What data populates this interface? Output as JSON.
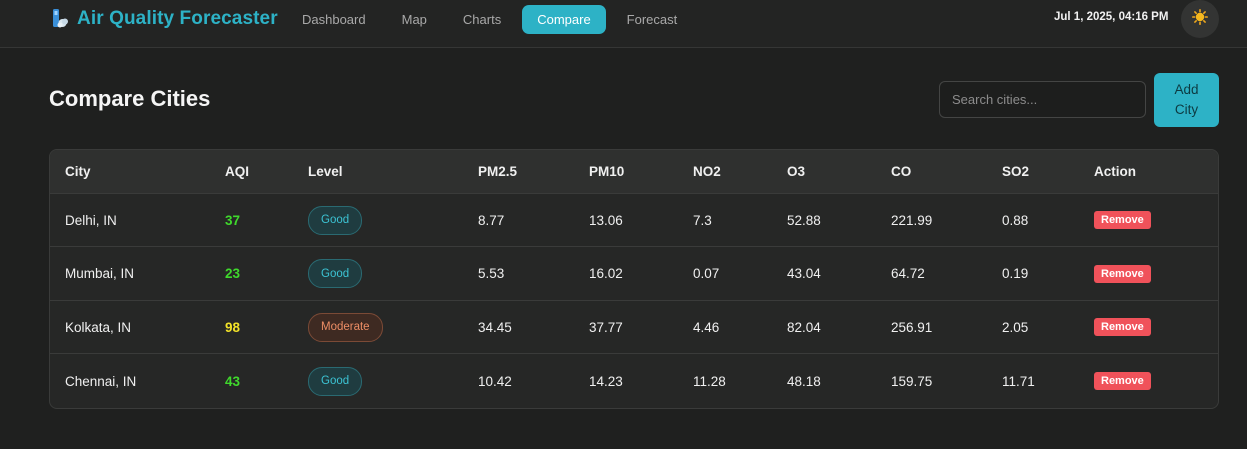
{
  "header": {
    "app_title": "Air Quality Forecaster",
    "nav": [
      {
        "label": "Dashboard",
        "active": false
      },
      {
        "label": "Map",
        "active": false
      },
      {
        "label": "Charts",
        "active": false
      },
      {
        "label": "Compare",
        "active": true
      },
      {
        "label": "Forecast",
        "active": false
      }
    ],
    "datetime": "Jul 1, 2025, 04:16 PM",
    "theme_icon": "sun-icon"
  },
  "main": {
    "title": "Compare Cities",
    "search_placeholder": "Search cities...",
    "add_button": "Add City"
  },
  "table": {
    "columns": [
      "City",
      "AQI",
      "Level",
      "PM2.5",
      "PM10",
      "NO2",
      "O3",
      "CO",
      "SO2",
      "Action"
    ],
    "rows": [
      {
        "city": "Delhi, IN",
        "aqi": "37",
        "level": "Good",
        "pm25": "8.77",
        "pm10": "13.06",
        "no2": "7.3",
        "o3": "52.88",
        "co": "221.99",
        "so2": "0.88",
        "action": "Remove"
      },
      {
        "city": "Mumbai, IN",
        "aqi": "23",
        "level": "Good",
        "pm25": "5.53",
        "pm10": "16.02",
        "no2": "0.07",
        "o3": "43.04",
        "co": "64.72",
        "so2": "0.19",
        "action": "Remove"
      },
      {
        "city": "Kolkata, IN",
        "aqi": "98",
        "level": "Moderate",
        "pm25": "34.45",
        "pm10": "37.77",
        "no2": "4.46",
        "o3": "82.04",
        "co": "256.91",
        "so2": "2.05",
        "action": "Remove"
      },
      {
        "city": "Chennai, IN",
        "aqi": "43",
        "level": "Good",
        "pm25": "10.42",
        "pm10": "14.23",
        "no2": "11.28",
        "o3": "48.18",
        "co": "159.75",
        "so2": "11.71",
        "action": "Remove"
      }
    ]
  },
  "colors": {
    "accent": "#2db2c6",
    "aqi_good": "#3fd92c",
    "aqi_moderate": "#f2e229",
    "remove": "#f0525a"
  }
}
